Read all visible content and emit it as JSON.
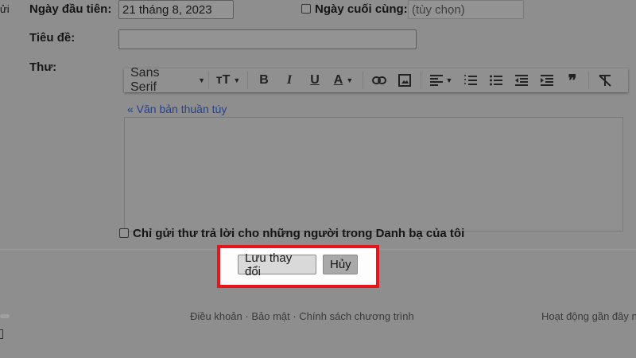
{
  "left_fragment": "ửi",
  "first_day": {
    "label": "Ngày đầu tiên:",
    "value": "21 tháng 8, 2023"
  },
  "last_day": {
    "label": "Ngày cuối cùng:",
    "placeholder": "(tùy chọn)",
    "checked": false
  },
  "subject": {
    "label": "Tiêu đề:",
    "value": ""
  },
  "message": {
    "label": "Thư:"
  },
  "toolbar": {
    "font": "Sans Serif",
    "size": "тT",
    "bold": "B",
    "italic": "I",
    "underline": "U",
    "color": "A",
    "quote": "❞"
  },
  "plain_text_link": "« Văn bản thuần túy",
  "contacts_only": {
    "label": "Chỉ gửi thư trả lời cho những người trong Danh bạ của tôi",
    "checked": false
  },
  "buttons": {
    "save": "Lưu thay đổi",
    "cancel": "Hủy"
  },
  "highlight_color": "#e8141b",
  "footer": {
    "links": "Điều khoản · Bảo mật · Chính sách chương trình",
    "activity": "Hoạt động gần đây n"
  }
}
